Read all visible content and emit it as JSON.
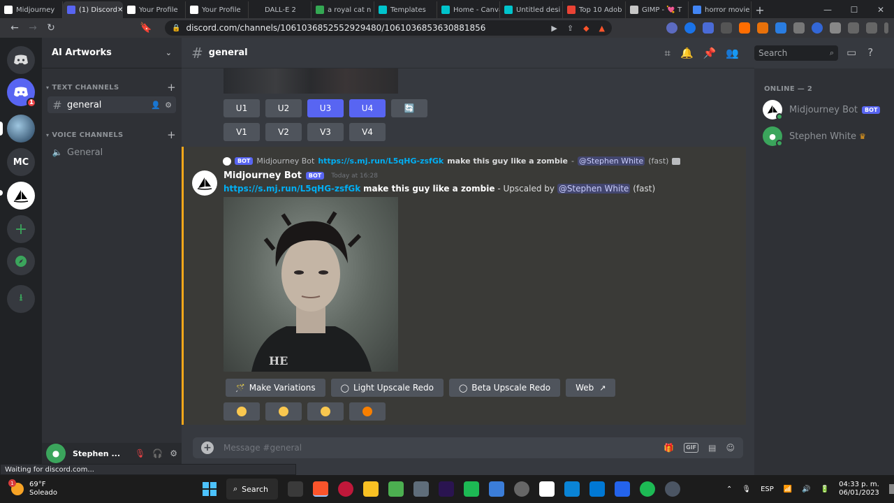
{
  "browser": {
    "tabs": [
      {
        "title": "Midjourney",
        "color": "#ffffff"
      },
      {
        "title": "(1) Discord",
        "color": "#5865f2"
      },
      {
        "title": "Your Profile",
        "color": "#ffffff"
      },
      {
        "title": "Your Profile",
        "color": "#ffffff"
      },
      {
        "title": "DALL-E 2",
        "color": "#202124"
      },
      {
        "title": "a royal cat n",
        "color": "#34a853"
      },
      {
        "title": "Templates",
        "color": "#00c4cc"
      },
      {
        "title": "Home - Canva",
        "color": "#00c4cc"
      },
      {
        "title": "Untitled desi",
        "color": "#00c4cc"
      },
      {
        "title": "Top 10 Adob",
        "color": "#ea4335"
      },
      {
        "title": "GIMP - 💘 T",
        "color": "#c7c7c7"
      },
      {
        "title": "horror movie",
        "color": "#4285f4"
      }
    ],
    "url": "discord.com/channels/1061036852552929480/1061036853630881856",
    "status_text": "Waiting for discord.com..."
  },
  "discord": {
    "server_name": "AI Artworks",
    "guild_labels": {
      "mc": "MC"
    },
    "notification_count": "1",
    "categories": {
      "text": "TEXT CHANNELS",
      "voice": "VOICE CHANNELS"
    },
    "channels": {
      "text_general": "general",
      "voice_general": "General"
    },
    "header": {
      "channel": "general",
      "search_placeholder": "Search"
    },
    "user": {
      "name": "Stephen ..."
    },
    "message1": {
      "buttons_row1": [
        "U1",
        "U2",
        "U3",
        "U4"
      ],
      "buttons_row2": [
        "V1",
        "V2",
        "V3",
        "V4"
      ]
    },
    "message2": {
      "reply_bot_tag": "BOT",
      "reply_author": "Midjourney Bot",
      "reply_link": "https://s.mj.run/L5qHG-zsfGk",
      "reply_prompt": "make this guy like a zombie",
      "reply_sep": "-",
      "reply_mention": "@Stephen White",
      "reply_speed": "(fast)",
      "author": "Midjourney Bot",
      "bot_tag": "BOT",
      "timestamp": "Today at 16:28",
      "link": "https://s.mj.run/L5qHG-zsfGk",
      "prompt": "make this guy like a zombie",
      "upscaled_by": "- Upscaled by",
      "mention": "@Stephen White",
      "speed": "(fast)",
      "action_buttons": {
        "make_variations": "Make Variations",
        "light_upscale": "Light Upscale Redo",
        "beta_upscale": "Beta Upscale Redo",
        "web": "Web"
      }
    },
    "composer_placeholder": "Message #general",
    "members": {
      "header": "ONLINE — 2",
      "list": [
        {
          "name": "Midjourney Bot",
          "tag": "BOT"
        },
        {
          "name": "Stephen White"
        }
      ]
    }
  },
  "taskbar": {
    "temperature": "69°F",
    "condition": "Soleado",
    "weather_badge": "1",
    "search_label": "Search",
    "language": "ESP",
    "time": "04:33 p. m.",
    "date": "06/01/2023"
  }
}
